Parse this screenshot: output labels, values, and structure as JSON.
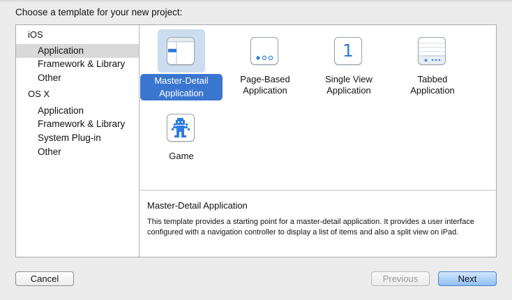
{
  "dialog": {
    "prompt": "Choose a template for your new project:"
  },
  "sidebar": {
    "sections": [
      {
        "heading": "iOS",
        "items": [
          "Application",
          "Framework & Library",
          "Other"
        ]
      },
      {
        "heading": "OS X",
        "items": [
          "Application",
          "Framework & Library",
          "System Plug-in",
          "Other"
        ]
      }
    ],
    "selected": "iOS / Application"
  },
  "templates": [
    {
      "line1": "Master-Detail",
      "line2": "Application",
      "icon": "master-detail-icon",
      "selected": true
    },
    {
      "line1": "Page-Based",
      "line2": "Application",
      "icon": "page-dots-icon",
      "selected": false
    },
    {
      "line1": "Single View",
      "line2": "Application",
      "icon": "number-one-icon",
      "glyph": "1",
      "selected": false
    },
    {
      "line1": "Tabbed",
      "line2": "Application",
      "icon": "tab-bar-icon",
      "selected": false
    },
    {
      "line1": "Game",
      "line2": "",
      "icon": "game-character-icon",
      "selected": false
    }
  ],
  "description": {
    "title": "Master-Detail Application",
    "body": "This template provides a starting point for a master-detail application. It provides a user interface configured with a navigation controller to display a list of items and also a split view on iPad."
  },
  "buttons": {
    "cancel": "Cancel",
    "previous": "Previous",
    "next": "Next"
  },
  "colors": {
    "accent": "#3a76d0",
    "selection_bg": "#cdddf0",
    "sidebar_selection": "#d9d9d9"
  }
}
